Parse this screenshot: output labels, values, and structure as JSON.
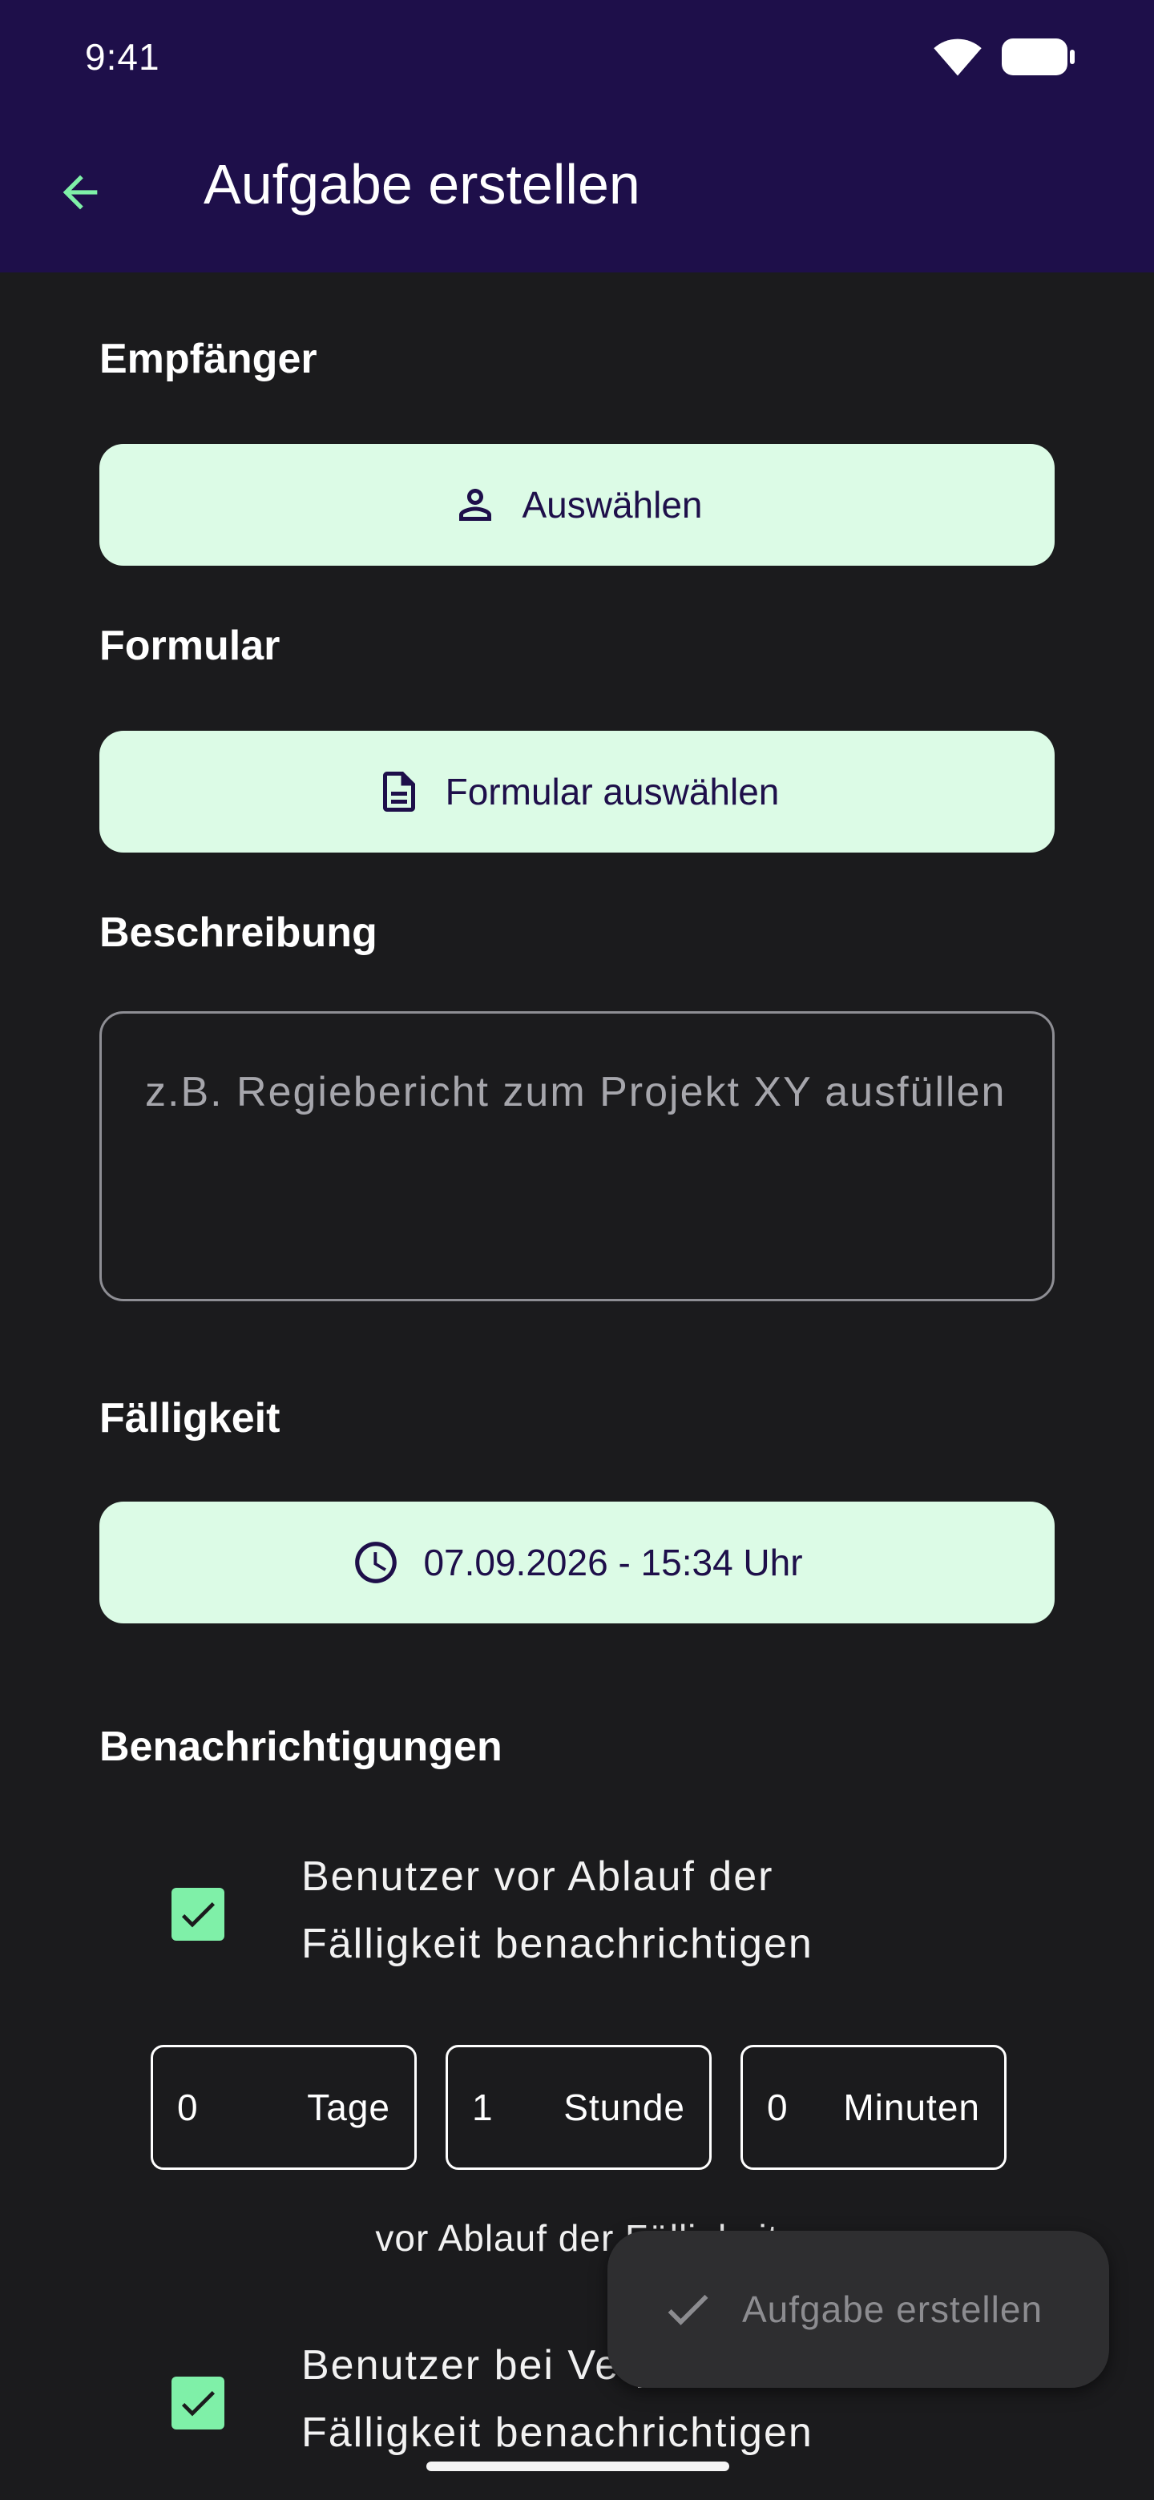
{
  "status_bar": {
    "time": "9:41"
  },
  "app_bar": {
    "title": "Aufgabe erstellen",
    "back_icon": "arrow-back-icon"
  },
  "sections": {
    "recipient": {
      "label": "Empfänger",
      "button_label": "Auswählen",
      "icon": "person-icon"
    },
    "form": {
      "label": "Formular",
      "button_label": "Formular auswählen",
      "icon": "document-icon"
    },
    "description": {
      "label": "Beschreibung",
      "placeholder": "z.B. Regiebericht zum Projekt XY ausfüllen"
    },
    "due": {
      "label": "Fälligkeit",
      "button_label": "07.09.2026 - 15:34 Uhr",
      "icon": "clock-icon"
    },
    "notifications": {
      "label": "Benachrichtigungen",
      "before_due": {
        "checked": true,
        "line1": "Benutzer vor Ablauf der",
        "line2": "Fälligkeit benachrichtigen"
      },
      "offset": {
        "days": {
          "value": "0",
          "unit": "Tage"
        },
        "hours": {
          "value": "1",
          "unit": "Stunde"
        },
        "minutes": {
          "value": "0",
          "unit": "Minuten"
        },
        "suffix": "vor Ablauf der Fälligkeit"
      },
      "missed_due": {
        "checked": true,
        "line1": "Benutzer bei Verpassen der",
        "line2": "Fälligkeit benachrichtigen"
      }
    }
  },
  "fab": {
    "label": "Aufgabe erstellen",
    "icon": "check-icon"
  },
  "colors": {
    "app_bar": "#1e0f4a",
    "background": "#1b1b1d",
    "mint_button": "#dcfbe6",
    "accent_green": "#7ff0a8",
    "on_mint": "#1e0f4a"
  }
}
